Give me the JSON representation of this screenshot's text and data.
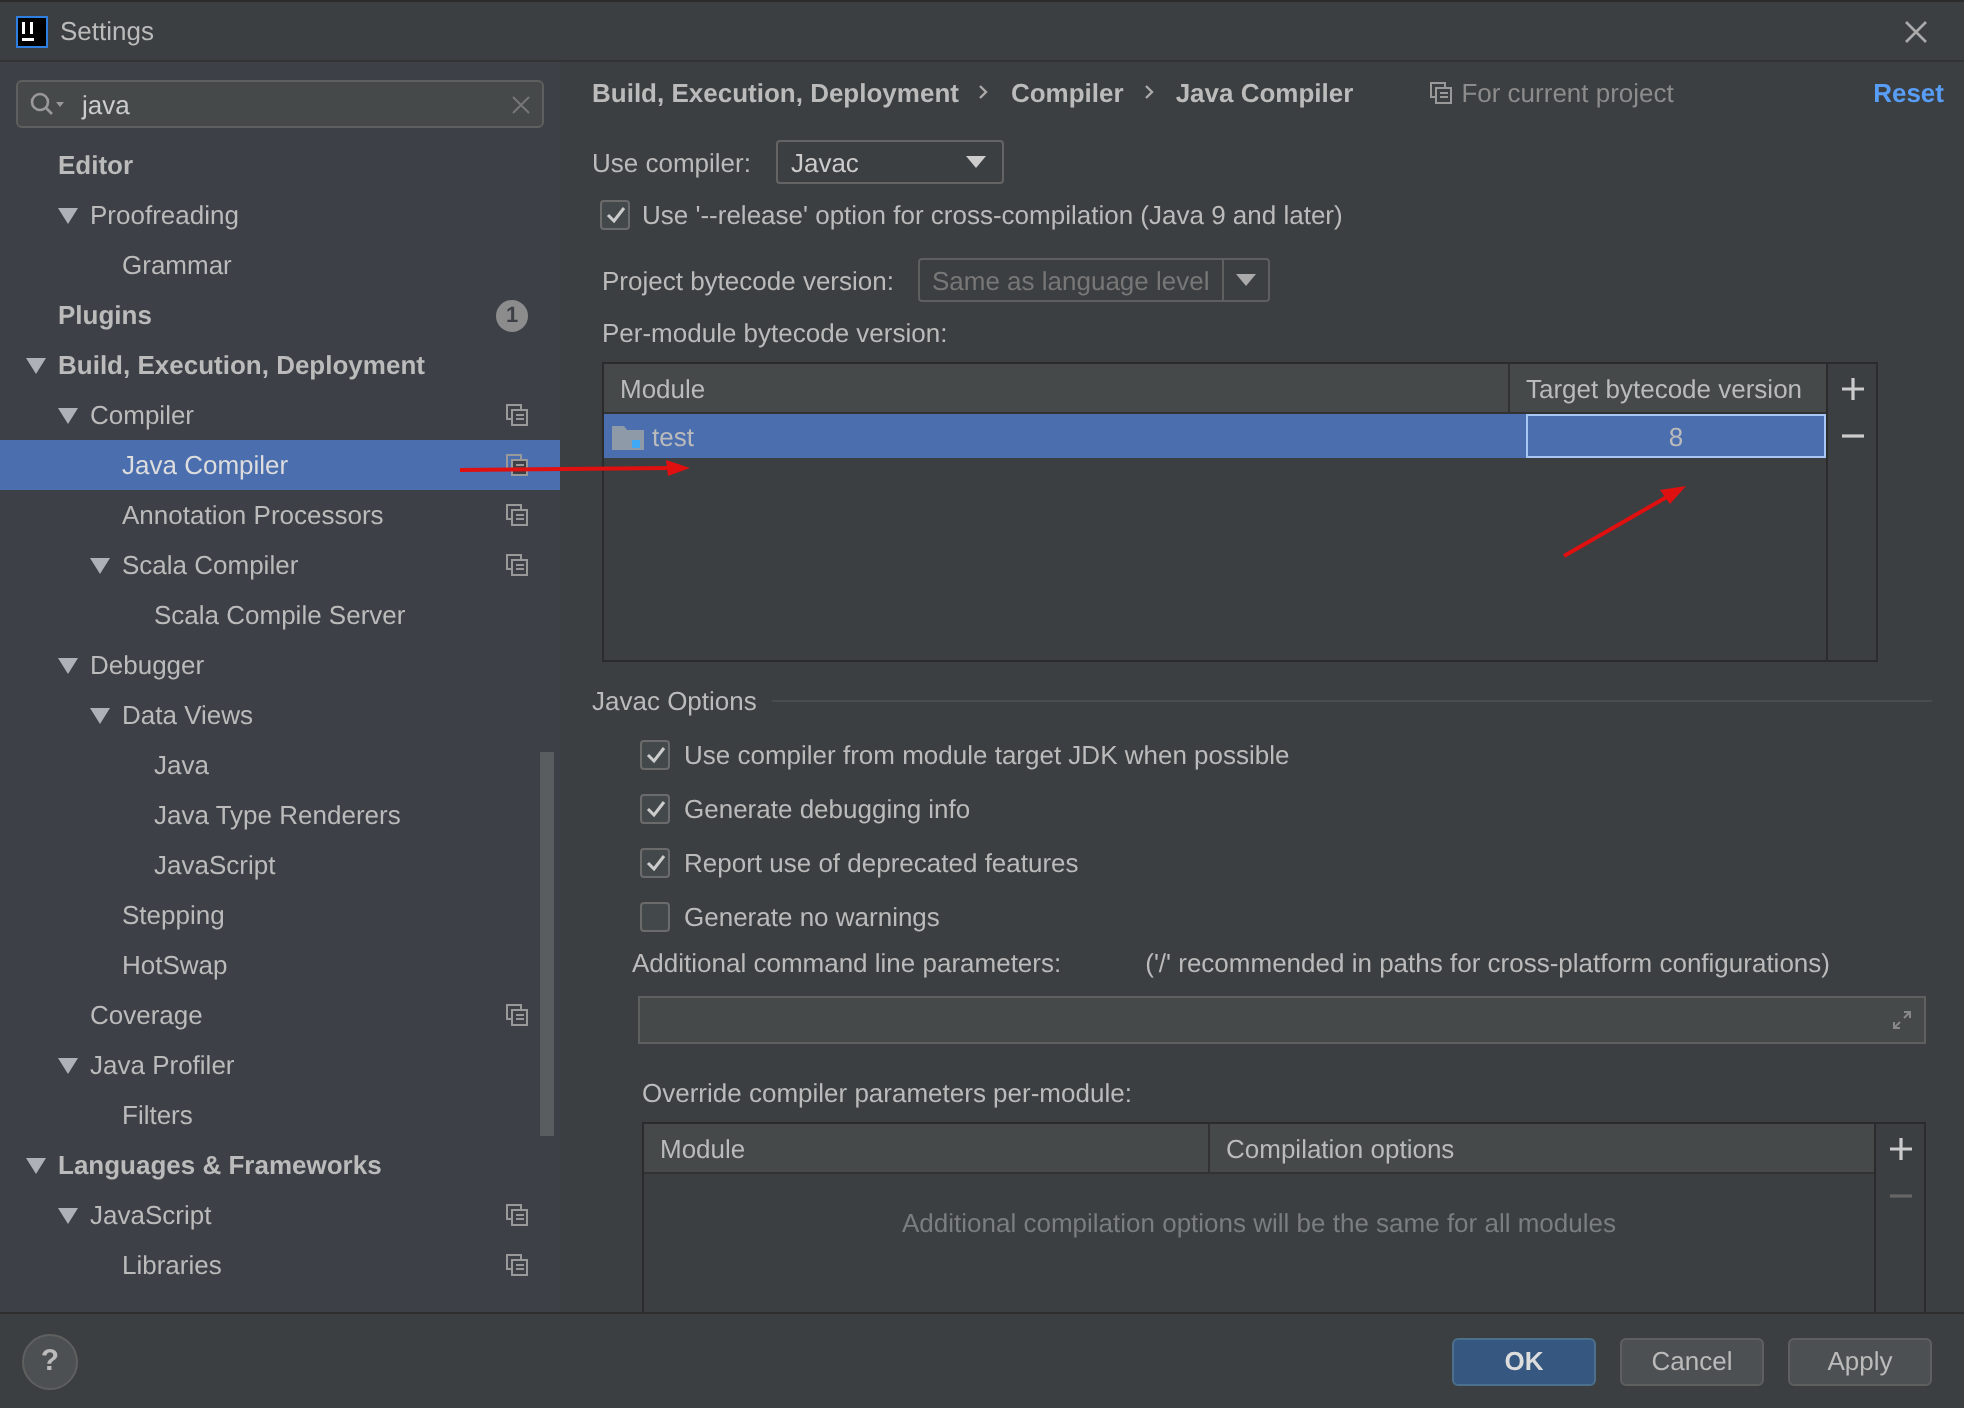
{
  "window": {
    "title": "Settings"
  },
  "search": {
    "value": "java"
  },
  "sidebar": {
    "items": [
      {
        "label": "Editor",
        "selected": false,
        "project_level": false,
        "children": [
          {
            "label": "Proofreading",
            "selected": false,
            "project_level": false,
            "expanded": true,
            "children": [
              {
                "label": "Grammar",
                "selected": false,
                "project_level": false
              }
            ]
          }
        ]
      },
      {
        "label": "Plugins",
        "selected": false,
        "project_level": false,
        "badge": "1"
      },
      {
        "label": "Build, Execution, Deployment",
        "selected": false,
        "project_level": false,
        "expanded": true,
        "children": [
          {
            "label": "Compiler",
            "selected": false,
            "project_level": true,
            "expanded": true,
            "children": [
              {
                "label": "Java Compiler",
                "selected": true,
                "project_level": true
              },
              {
                "label": "Annotation Processors",
                "selected": false,
                "project_level": true
              },
              {
                "label": "Scala Compiler",
                "selected": false,
                "project_level": true,
                "expanded": true,
                "children": [
                  {
                    "label": "Scala Compile Server",
                    "selected": false,
                    "project_level": false
                  }
                ]
              }
            ]
          },
          {
            "label": "Debugger",
            "selected": false,
            "project_level": false,
            "expanded": true,
            "children": [
              {
                "label": "Data Views",
                "selected": false,
                "project_level": false,
                "expanded": true,
                "children": [
                  {
                    "label": "Java",
                    "selected": false,
                    "project_level": false
                  },
                  {
                    "label": "Java Type Renderers",
                    "selected": false,
                    "project_level": false
                  },
                  {
                    "label": "JavaScript",
                    "selected": false,
                    "project_level": false
                  }
                ]
              },
              {
                "label": "Stepping",
                "selected": false,
                "project_level": false
              },
              {
                "label": "HotSwap",
                "selected": false,
                "project_level": false
              }
            ]
          },
          {
            "label": "Coverage",
            "selected": false,
            "project_level": true
          },
          {
            "label": "Java Profiler",
            "selected": false,
            "project_level": false,
            "expanded": true,
            "children": [
              {
                "label": "Filters",
                "selected": false,
                "project_level": false
              }
            ]
          }
        ]
      },
      {
        "label": "Languages & Frameworks",
        "selected": false,
        "project_level": false,
        "expanded": true,
        "children": [
          {
            "label": "JavaScript",
            "selected": false,
            "project_level": true,
            "expanded": true,
            "children": [
              {
                "label": "Libraries",
                "selected": false,
                "project_level": true
              }
            ]
          }
        ]
      }
    ]
  },
  "breadcrumb": [
    "Build, Execution, Deployment",
    "Compiler",
    "Java Compiler"
  ],
  "scope_note": "For current project",
  "reset_link": "Reset",
  "use_compiler": {
    "label": "Use compiler:",
    "value": "Javac"
  },
  "release_option": {
    "label": "Use '--release' option for cross-compilation (Java 9 and later)",
    "checked": true
  },
  "project_bytecode": {
    "label": "Project bytecode version:",
    "value": "Same as language level",
    "disabled": true
  },
  "per_module": {
    "label": "Per-module bytecode version:",
    "columns": [
      "Module",
      "Target bytecode version"
    ],
    "rows": [
      {
        "module": "test",
        "target": "8",
        "selected": true
      }
    ]
  },
  "javac_options": {
    "title": "Javac Options",
    "checkboxes": [
      {
        "label": "Use compiler from module target JDK when possible",
        "checked": true
      },
      {
        "label": "Generate debugging info",
        "checked": true
      },
      {
        "label": "Report use of deprecated features",
        "checked": true
      },
      {
        "label": "Generate no warnings",
        "checked": false
      }
    ],
    "params_label": "Additional command line parameters:",
    "params_hint": "('/' recommended in paths for cross-platform configurations)"
  },
  "override": {
    "label": "Override compiler parameters per-module:",
    "columns": [
      "Module",
      "Compilation options"
    ],
    "empty_text": "Additional compilation options will be the same for all modules"
  },
  "help_button": "?",
  "buttons": [
    {
      "label": "OK",
      "default": true
    },
    {
      "label": "Cancel",
      "default": false
    },
    {
      "label": "Apply",
      "default": false
    }
  ]
}
